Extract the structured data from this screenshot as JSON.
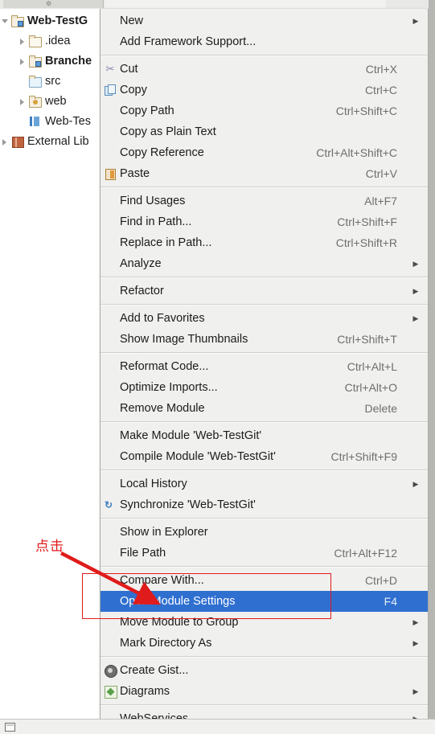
{
  "window": {
    "accent_blue": "#2f6fd0",
    "menu_bg": "#f0f0ee",
    "annotation_red": "#e01b1b"
  },
  "sidebar": {
    "items": [
      {
        "label": "Web-TestG",
        "icon": "module-folder-icon",
        "arrow": "open",
        "bold": true,
        "indent": 0
      },
      {
        "label": ".idea",
        "icon": "folder-icon",
        "arrow": "closed",
        "bold": false,
        "indent": 1
      },
      {
        "label": "Branche",
        "icon": "module-folder-icon",
        "arrow": "closed",
        "bold": true,
        "indent": 1
      },
      {
        "label": "src",
        "icon": "source-folder-icon",
        "arrow": "none",
        "bold": false,
        "indent": 1
      },
      {
        "label": "web",
        "icon": "web-folder-icon",
        "arrow": "closed",
        "bold": false,
        "indent": 1
      },
      {
        "label": "Web-Tes",
        "icon": "iml-file-icon",
        "arrow": "none",
        "bold": false,
        "indent": 1
      },
      {
        "label": "External Lib",
        "icon": "library-icon",
        "arrow": "closed",
        "bold": false,
        "indent": 0
      }
    ]
  },
  "context_menu": {
    "items": [
      {
        "type": "item",
        "label": "New",
        "accel": "",
        "submenu": true,
        "icon": "none",
        "mnemonic": ""
      },
      {
        "type": "item",
        "label": "Add Framework Support...",
        "accel": "",
        "submenu": false,
        "icon": "none",
        "mnemonic": ""
      },
      {
        "type": "sep"
      },
      {
        "type": "item",
        "label": "Cut",
        "accel": "Ctrl+X",
        "submenu": false,
        "icon": "cut-icon",
        "mnemonic": "t"
      },
      {
        "type": "item",
        "label": "Copy",
        "accel": "Ctrl+C",
        "submenu": false,
        "icon": "copy-icon",
        "mnemonic": "C"
      },
      {
        "type": "item",
        "label": "Copy Path",
        "accel": "Ctrl+Shift+C",
        "submenu": false,
        "icon": "none",
        "mnemonic": "o"
      },
      {
        "type": "item",
        "label": "Copy as Plain Text",
        "accel": "",
        "submenu": false,
        "icon": "none",
        "mnemonic": ""
      },
      {
        "type": "item",
        "label": "Copy Reference",
        "accel": "Ctrl+Alt+Shift+C",
        "submenu": false,
        "icon": "none",
        "mnemonic": "y"
      },
      {
        "type": "item",
        "label": "Paste",
        "accel": "Ctrl+V",
        "submenu": false,
        "icon": "paste-icon",
        "mnemonic": "P"
      },
      {
        "type": "sep"
      },
      {
        "type": "item",
        "label": "Find Usages",
        "accel": "Alt+F7",
        "submenu": false,
        "icon": "none",
        "mnemonic": "U"
      },
      {
        "type": "item",
        "label": "Find in Path...",
        "accel": "Ctrl+Shift+F",
        "submenu": false,
        "icon": "none",
        "mnemonic": "P"
      },
      {
        "type": "item",
        "label": "Replace in Path...",
        "accel": "Ctrl+Shift+R",
        "submenu": false,
        "icon": "none",
        "mnemonic": "a"
      },
      {
        "type": "item",
        "label": "Analyze",
        "accel": "",
        "submenu": true,
        "icon": "none",
        "mnemonic": "z"
      },
      {
        "type": "sep"
      },
      {
        "type": "item",
        "label": "Refactor",
        "accel": "",
        "submenu": true,
        "icon": "none",
        "mnemonic": "R"
      },
      {
        "type": "sep"
      },
      {
        "type": "item",
        "label": "Add to Favorites",
        "accel": "",
        "submenu": true,
        "icon": "none",
        "mnemonic": "F"
      },
      {
        "type": "item",
        "label": "Show Image Thumbnails",
        "accel": "Ctrl+Shift+T",
        "submenu": false,
        "icon": "none",
        "mnemonic": ""
      },
      {
        "type": "sep"
      },
      {
        "type": "item",
        "label": "Reformat Code...",
        "accel": "Ctrl+Alt+L",
        "submenu": false,
        "icon": "none",
        "mnemonic": "R"
      },
      {
        "type": "item",
        "label": "Optimize Imports...",
        "accel": "Ctrl+Alt+O",
        "submenu": false,
        "icon": "none",
        "mnemonic": "z"
      },
      {
        "type": "item",
        "label": "Remove Module",
        "accel": "Delete",
        "submenu": false,
        "icon": "none",
        "mnemonic": ""
      },
      {
        "type": "sep"
      },
      {
        "type": "item",
        "label": "Make Module 'Web-TestGit'",
        "accel": "",
        "submenu": false,
        "icon": "none",
        "mnemonic": "M"
      },
      {
        "type": "item",
        "label": "Compile Module 'Web-TestGit'",
        "accel": "Ctrl+Shift+F9",
        "submenu": false,
        "icon": "none",
        "mnemonic": "e"
      },
      {
        "type": "sep"
      },
      {
        "type": "item",
        "label": "Local History",
        "accel": "",
        "submenu": true,
        "icon": "none",
        "mnemonic": "H"
      },
      {
        "type": "item",
        "label": "Synchronize 'Web-TestGit'",
        "accel": "",
        "submenu": false,
        "icon": "sync-icon",
        "mnemonic": ""
      },
      {
        "type": "sep"
      },
      {
        "type": "item",
        "label": "Show in Explorer",
        "accel": "",
        "submenu": false,
        "icon": "none",
        "mnemonic": ""
      },
      {
        "type": "item",
        "label": "File Path",
        "accel": "Ctrl+Alt+F12",
        "submenu": false,
        "icon": "none",
        "mnemonic": "P"
      },
      {
        "type": "sep"
      },
      {
        "type": "item",
        "label": "Compare With...",
        "accel": "Ctrl+D",
        "submenu": false,
        "icon": "none",
        "mnemonic": ""
      },
      {
        "type": "item",
        "label": "Open Module Settings",
        "accel": "F4",
        "submenu": false,
        "icon": "none",
        "mnemonic": "",
        "selected": true
      },
      {
        "type": "item",
        "label": "Move Module to Group",
        "accel": "",
        "submenu": true,
        "icon": "none",
        "mnemonic": ""
      },
      {
        "type": "item",
        "label": "Mark Directory As",
        "accel": "",
        "submenu": true,
        "icon": "none",
        "mnemonic": ""
      },
      {
        "type": "sep"
      },
      {
        "type": "item",
        "label": "Create Gist...",
        "accel": "",
        "submenu": false,
        "icon": "gist-icon",
        "mnemonic": ""
      },
      {
        "type": "item",
        "label": "Diagrams",
        "accel": "",
        "submenu": true,
        "icon": "diagram-icon",
        "mnemonic": ""
      },
      {
        "type": "sep"
      },
      {
        "type": "item",
        "label": "WebServices",
        "accel": "",
        "submenu": true,
        "icon": "none",
        "mnemonic": ""
      }
    ]
  },
  "annotation": {
    "text": "点击",
    "color": "#e01b1b"
  }
}
